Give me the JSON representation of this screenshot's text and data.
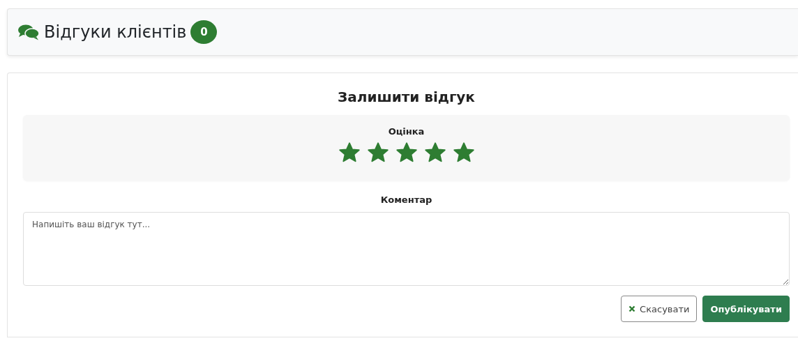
{
  "header": {
    "title": "Відгуки клієнтів",
    "count": "0"
  },
  "form": {
    "title": "Залишити відгук",
    "rating": {
      "label": "Оцінка",
      "stars": 5
    },
    "comment": {
      "label": "Коментар",
      "placeholder": "Напишіть ваш відгук тут..."
    },
    "buttons": [
      {
        "kind": "cancel",
        "label": "Скасувати"
      },
      {
        "kind": "submit",
        "label": "Опублікувати"
      }
    ]
  }
}
